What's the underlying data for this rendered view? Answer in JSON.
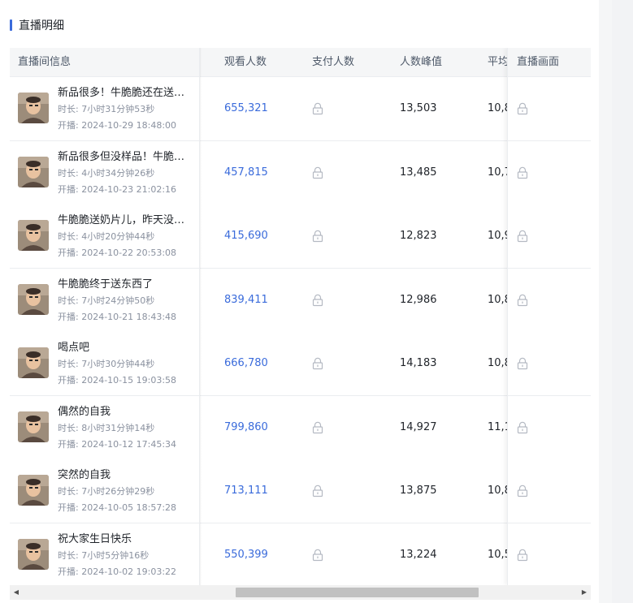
{
  "section": {
    "title": "直播明细"
  },
  "columns": {
    "info": "直播间信息",
    "views": "观看人数",
    "payers": "支付人数",
    "peak": "人数峰值",
    "avg": "平均",
    "screen": "直播画面"
  },
  "labels": {
    "duration_prefix": "时长: ",
    "start_prefix": "开播: "
  },
  "rows": [
    {
      "title": "新品很多！牛脆脆还在送…",
      "duration": "7小时31分钟53秒",
      "start": "2024-10-29 18:48:00",
      "views": "655,321",
      "peak": "13,503",
      "avg": "10,8"
    },
    {
      "title": "新品很多但没样品！牛脆…",
      "duration": "4小时34分钟26秒",
      "start": "2024-10-23 21:02:16",
      "views": "457,815",
      "peak": "13,485",
      "avg": "10,7"
    },
    {
      "title": "牛脆脆送奶片儿，昨天没…",
      "duration": "4小时20分钟44秒",
      "start": "2024-10-22 20:53:08",
      "views": "415,690",
      "peak": "12,823",
      "avg": "10,9"
    },
    {
      "title": "牛脆脆终于送东西了",
      "duration": "7小时24分钟50秒",
      "start": "2024-10-21 18:43:48",
      "views": "839,411",
      "peak": "12,986",
      "avg": "10,8"
    },
    {
      "title": "喝点吧",
      "duration": "7小时30分钟44秒",
      "start": "2024-10-15 19:03:58",
      "views": "666,780",
      "peak": "14,183",
      "avg": "10,8"
    },
    {
      "title": "偶然的自我",
      "duration": "8小时31分钟14秒",
      "start": "2024-10-12 17:45:34",
      "views": "799,860",
      "peak": "14,927",
      "avg": "11,1"
    },
    {
      "title": "突然的自我",
      "duration": "7小时26分钟29秒",
      "start": "2024-10-05 18:57:28",
      "views": "713,111",
      "peak": "13,875",
      "avg": "10,8"
    },
    {
      "title": "祝大家生日快乐",
      "duration": "7小时5分钟16秒",
      "start": "2024-10-02 19:03:22",
      "views": "550,399",
      "peak": "13,224",
      "avg": "10,5"
    }
  ],
  "icons": {
    "locked": "lock-icon",
    "thumbnail": "live-thumbnail-icon"
  },
  "colors": {
    "accent": "#3a6bdb",
    "muted": "#8a919f",
    "lock": "#b4b9c2"
  }
}
